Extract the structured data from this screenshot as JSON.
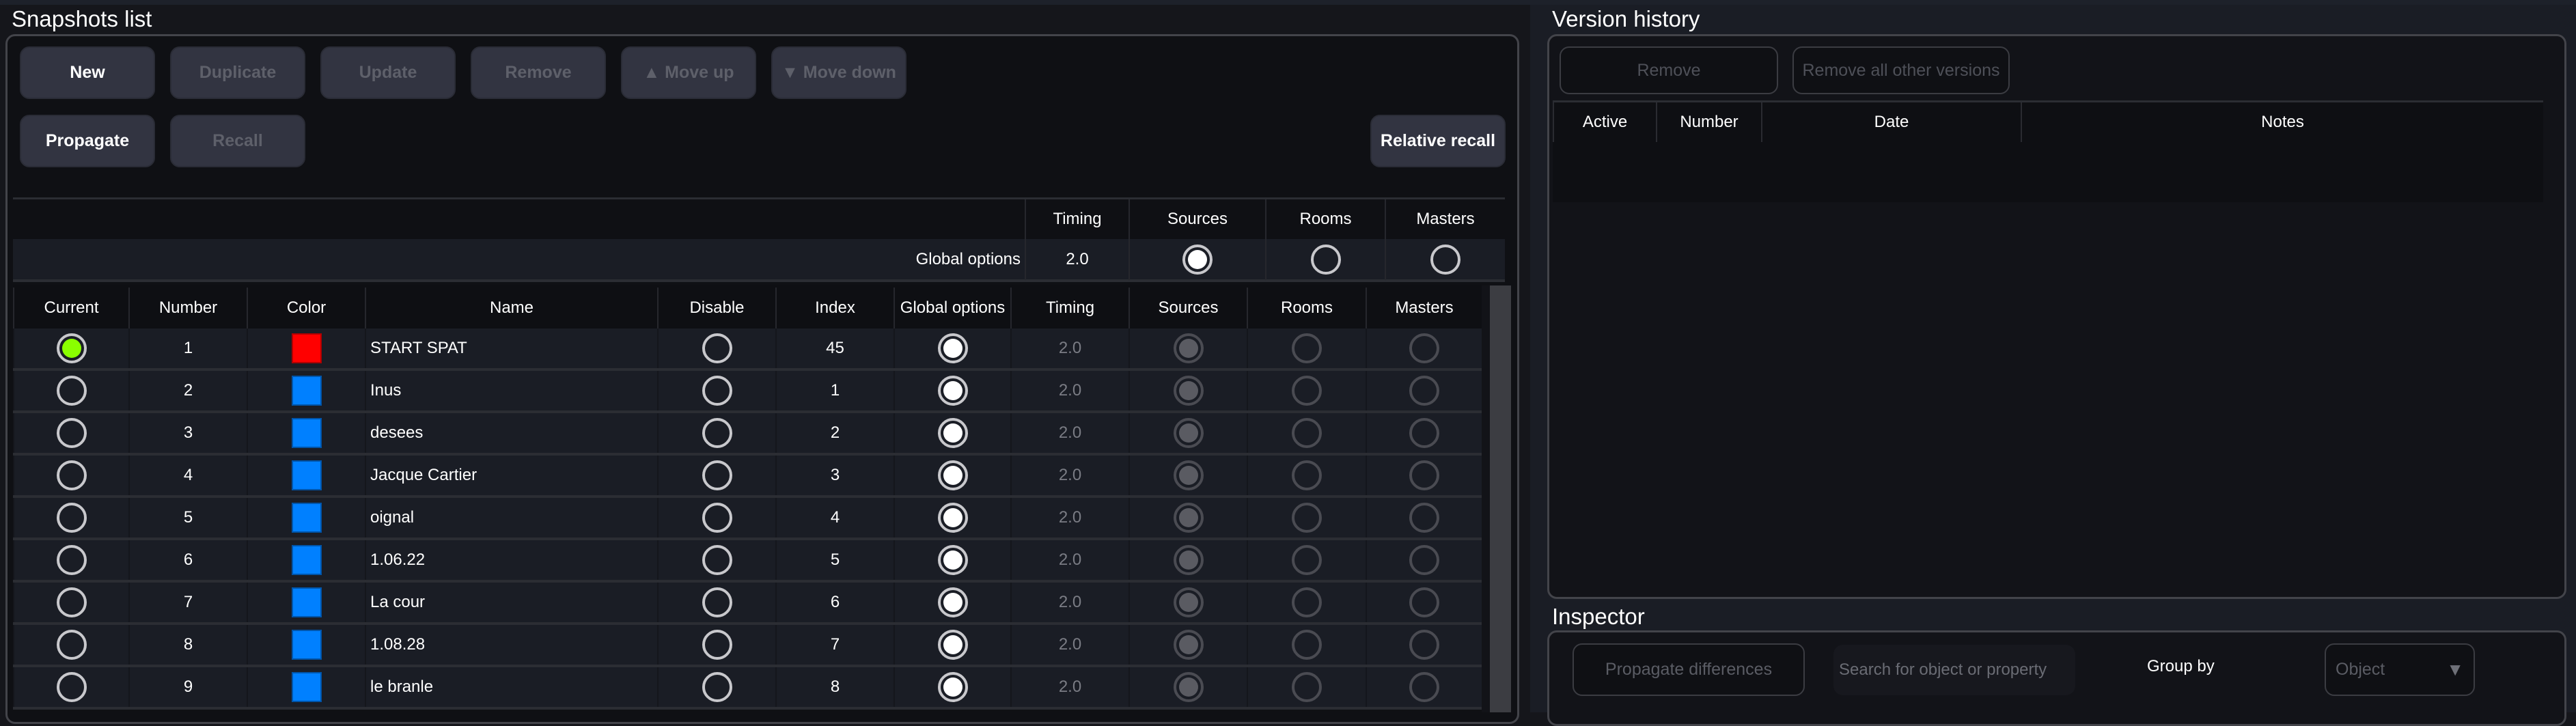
{
  "snapshots": {
    "title": "Snapshots list",
    "buttons_row1": [
      {
        "label": "New",
        "enabled": true
      },
      {
        "label": "Duplicate",
        "enabled": false
      },
      {
        "label": "Update",
        "enabled": false
      },
      {
        "label": "Remove",
        "enabled": false
      },
      {
        "label": "▲ Move up",
        "enabled": false
      },
      {
        "label": "▼ Move down",
        "enabled": false
      }
    ],
    "buttons_row2": [
      {
        "label": "Propagate",
        "enabled": true
      },
      {
        "label": "Recall",
        "enabled": false
      }
    ],
    "relative_recall_label": "Relative recall",
    "global_options": {
      "row_label": "Global options",
      "headers": [
        "Timing",
        "Sources",
        "Rooms",
        "Masters"
      ],
      "timing": "2.0",
      "sources": "checked",
      "rooms": "unchecked",
      "masters": "unchecked"
    },
    "columns": [
      "Current",
      "Number",
      "Color",
      "Name",
      "Disable",
      "Index",
      "Global options",
      "Timing",
      "Sources",
      "Rooms",
      "Masters"
    ],
    "rows": [
      {
        "current": true,
        "number": "1",
        "color": "#ff0000",
        "name": "START SPAT",
        "disable": false,
        "index": "45",
        "global": true,
        "timing": "2.0",
        "sources": true,
        "rooms": false,
        "masters": false
      },
      {
        "current": false,
        "number": "2",
        "color": "#0080ff",
        "name": "Inus",
        "disable": false,
        "index": "1",
        "global": true,
        "timing": "2.0",
        "sources": true,
        "rooms": false,
        "masters": false
      },
      {
        "current": false,
        "number": "3",
        "color": "#0080ff",
        "name": "desees",
        "disable": false,
        "index": "2",
        "global": true,
        "timing": "2.0",
        "sources": true,
        "rooms": false,
        "masters": false
      },
      {
        "current": false,
        "number": "4",
        "color": "#0080ff",
        "name": "Jacque  Cartier",
        "disable": false,
        "index": "3",
        "global": true,
        "timing": "2.0",
        "sources": true,
        "rooms": false,
        "masters": false
      },
      {
        "current": false,
        "number": "5",
        "color": "#0080ff",
        "name": "oignal",
        "disable": false,
        "index": "4",
        "global": true,
        "timing": "2.0",
        "sources": true,
        "rooms": false,
        "masters": false
      },
      {
        "current": false,
        "number": "6",
        "color": "#0080ff",
        "name": "1.06.22",
        "disable": false,
        "index": "5",
        "global": true,
        "timing": "2.0",
        "sources": true,
        "rooms": false,
        "masters": false
      },
      {
        "current": false,
        "number": "7",
        "color": "#0080ff",
        "name": "La cour",
        "disable": false,
        "index": "6",
        "global": true,
        "timing": "2.0",
        "sources": true,
        "rooms": false,
        "masters": false
      },
      {
        "current": false,
        "number": "8",
        "color": "#0080ff",
        "name": "1.08.28",
        "disable": false,
        "index": "7",
        "global": true,
        "timing": "2.0",
        "sources": true,
        "rooms": false,
        "masters": false
      },
      {
        "current": false,
        "number": "9",
        "color": "#0080ff",
        "name": "le branle",
        "disable": false,
        "index": "8",
        "global": true,
        "timing": "2.0",
        "sources": true,
        "rooms": false,
        "masters": false
      }
    ]
  },
  "version_history": {
    "title": "Version history",
    "buttons": [
      {
        "label": "Remove",
        "enabled": false
      },
      {
        "label": "Remove all other versions",
        "enabled": false
      }
    ],
    "columns": [
      "Active",
      "Number",
      "Date",
      "Notes"
    ],
    "rows": []
  },
  "inspector": {
    "title": "Inspector",
    "propagate_label": "Propagate differences",
    "search_placeholder": "Search for object or property",
    "group_by_label": "Group by",
    "group_by_value": "Object"
  },
  "colors": {
    "current_indicator": "#8aff00",
    "snapshot_red": "#ff0000",
    "snapshot_blue": "#0080ff"
  }
}
